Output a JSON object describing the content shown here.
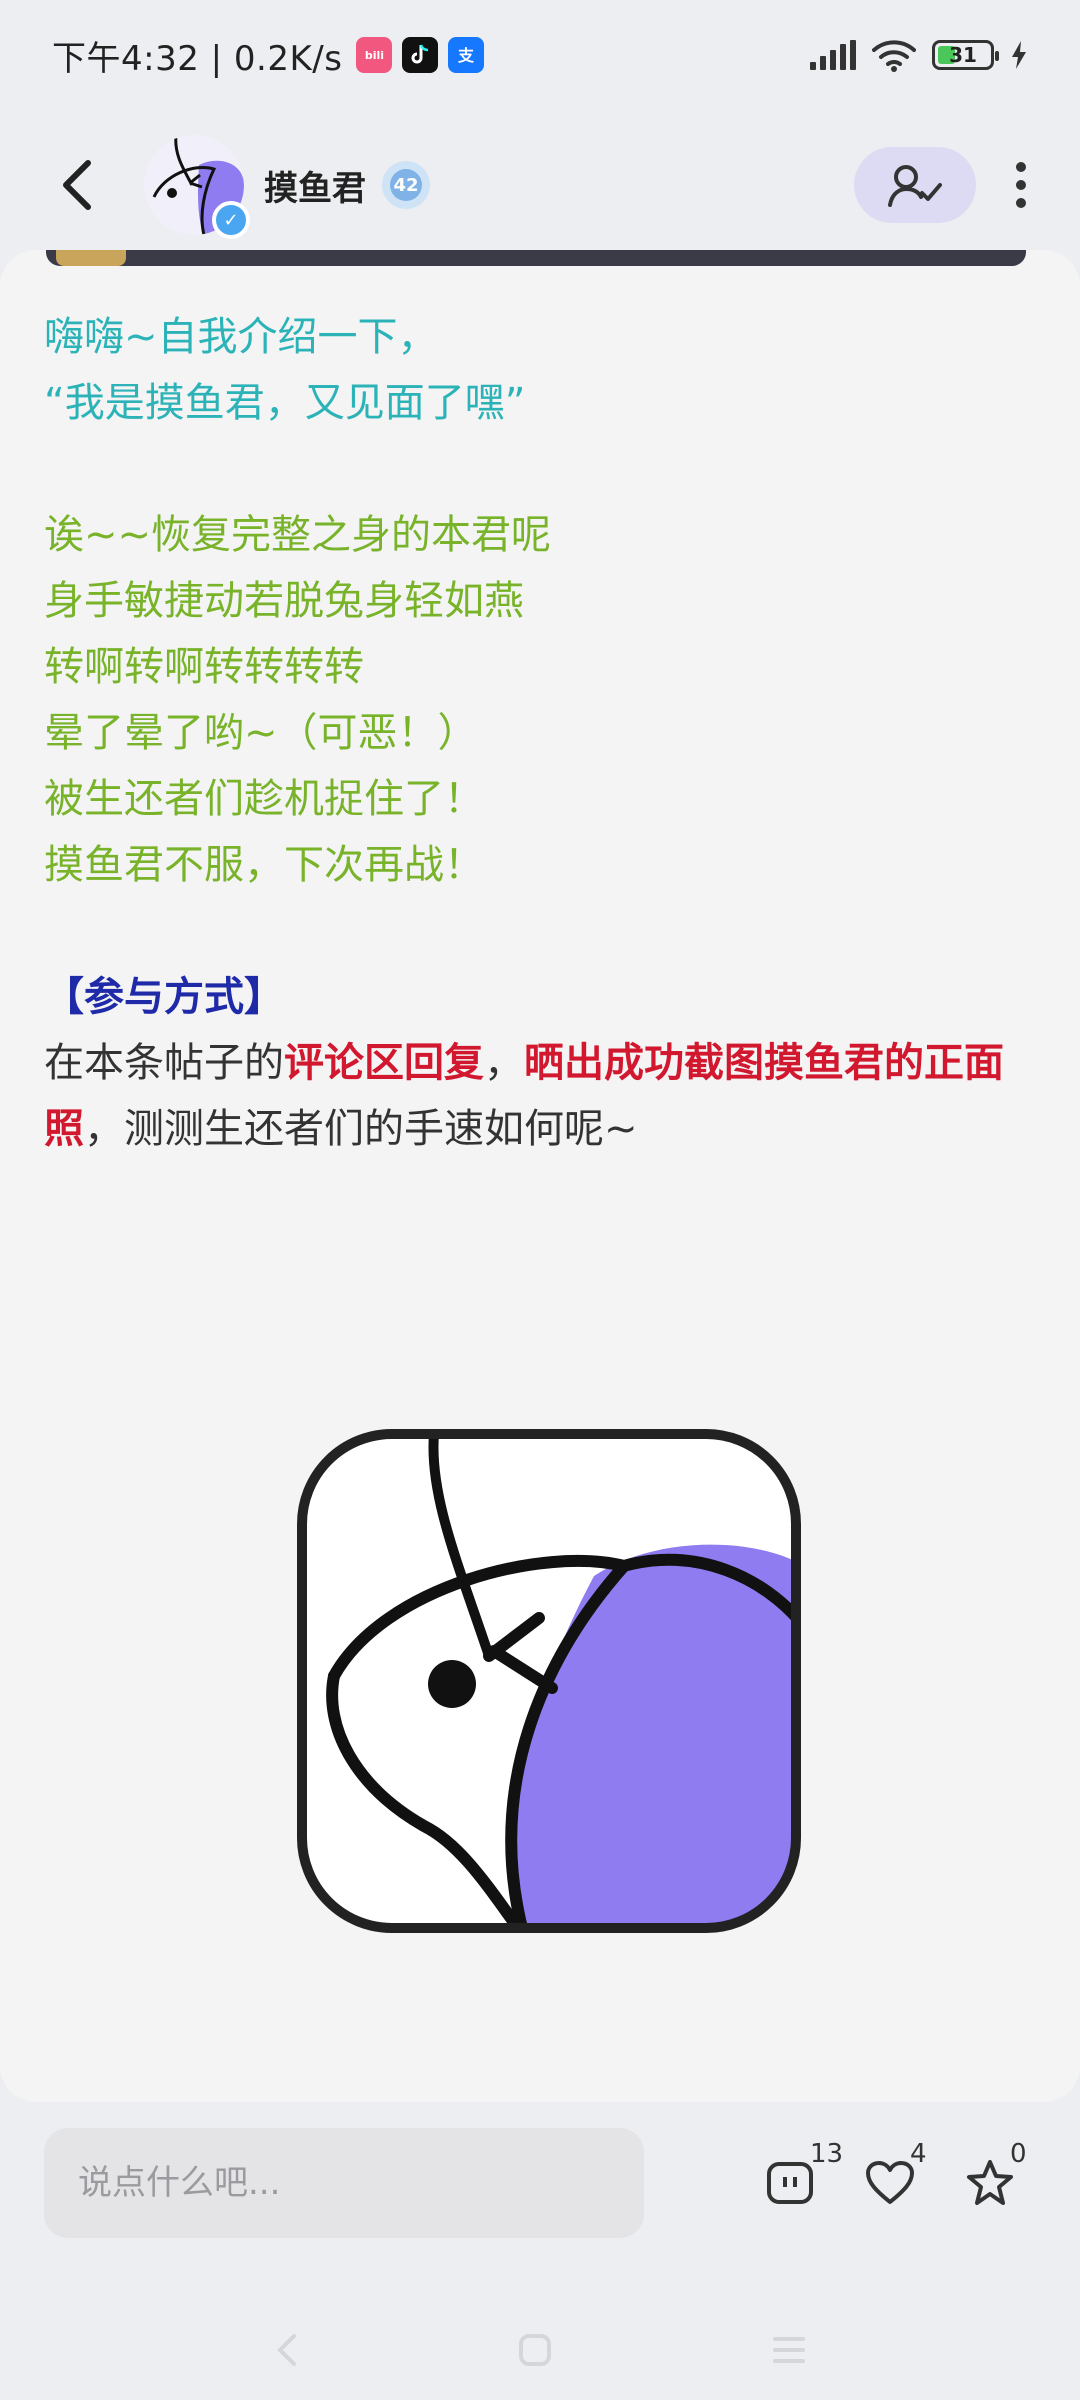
{
  "status_bar": {
    "time": "下午4:32 | 0.2K/s",
    "battery": "31",
    "app_icons": [
      "bilibili-icon",
      "tiktok-icon",
      "alipay-icon"
    ]
  },
  "header": {
    "username": "摸鱼君",
    "level": "42"
  },
  "post": {
    "line1": "嗨嗨~自我介绍一下，",
    "line2": "“我是摸鱼君，又见面了嘿”",
    "line3": "诶~~恢复完整之身的本君呢",
    "line4": "身手敏捷动若脱兔身轻如燕",
    "line5": "转啊转啊转转转转",
    "line6": "晕了晕了哟~（可恶！）",
    "line7": "被生还者们趁机捉住了！",
    "line8": "摸鱼君不服，下次再战！",
    "section_title": "【参与方式】",
    "rule_part1": "在本条帖子的",
    "rule_red1": "评论区回复",
    "rule_comma": "，",
    "rule_red2": "晒出成功截图摸鱼君的正面照",
    "rule_part2": "，测测生还者们的手速如何呢~"
  },
  "bottom_bar": {
    "comment_placeholder": "说点什么吧...",
    "comments_count": "13",
    "likes_count": "4",
    "favorites_count": "0"
  },
  "colors": {
    "teal": "#2bb3b7",
    "green": "#78b32a",
    "section_blue": "#1f2aa8",
    "highlight_red": "#d2182e",
    "fish_purple": "#8f7cf0"
  }
}
